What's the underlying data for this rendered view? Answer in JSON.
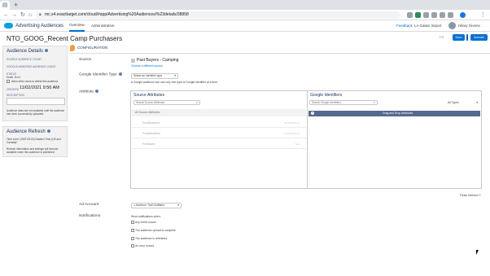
{
  "browser": {
    "tab_icon": "page-icon",
    "url": "mc.s4.exacttarget.com/cloud/#app/Advertising%20Audiences/%23details/38858"
  },
  "app": {
    "name": "Advertising Audiences",
    "nav_tabs": [
      "Overview",
      "Administration"
    ],
    "feedback": "Feedback",
    "business_unit": "LA Galaxi Import",
    "user": "Hilary Givens"
  },
  "page": {
    "title": "NTO_GOOG_Recent Camp Purchasers",
    "save_label": "Save",
    "activate_label": "Activate",
    "subtab": "CONFIGURATION"
  },
  "details": {
    "heading": "Audience Details",
    "source_label": "SOURCE AUDIENCE COUNT",
    "google_label": "GOOGLE ADWORDS AUDIENCE COUNT",
    "status_label": "STATUS",
    "status_value": "Draft",
    "status_extra": "Beta",
    "allow_label": "Allow other users to delete this audience",
    "created_label": "CREATED",
    "created_value": "11/02/2021 9:56 AM",
    "description_label": "DESCRIPTION",
    "note": "Audience stats are not available until the audience has been successfully uploaded."
  },
  "refresh": {
    "heading": "Audience Refresh",
    "timezone": "Time zone: (GMT-05:00) Eastern Time (US and Canada)*",
    "note": "Refresh information and settings will become available when this audience is published."
  },
  "form": {
    "source_label": "Source",
    "source_name": "Past Buyers - Camping",
    "source_link": "Choose a different source",
    "gid_label": "Google Identifier Type",
    "gid_select": "Select an identifier type",
    "gid_help": "A Google audience can use only one type of Google identifier at a time.",
    "attribute_label": "Attribute",
    "source_attrs_heading": "Source Attributes",
    "source_attrs_search": "Search Source Attributes",
    "source_attrs_listhdr": "All Source Attributes",
    "attr_rows": [
      {
        "name": "EmailAddress",
        "type": "EmailAddress"
      },
      {
        "name": "PostalAddress",
        "type": "PostalAddress"
      },
      {
        "name": "FirstName",
        "type": "Text"
      }
    ],
    "google_heading": "Google Identifiers",
    "google_search": "Search Google Identifiers",
    "google_filter": "All Types",
    "drop_text": "Drag and Drop Attributes",
    "fields_defined": "Fields Defined: 0",
    "ad_account_label": "Ad Account",
    "ad_account_value": "Northern Trail Outfitters",
    "notifications_label": "Notifications",
    "notifications_intro": "Send notifications when:",
    "notifications": [
      "Any event occurs",
      "The audience upload is complete",
      "The audience is refreshed",
      "An error occurs"
    ]
  }
}
